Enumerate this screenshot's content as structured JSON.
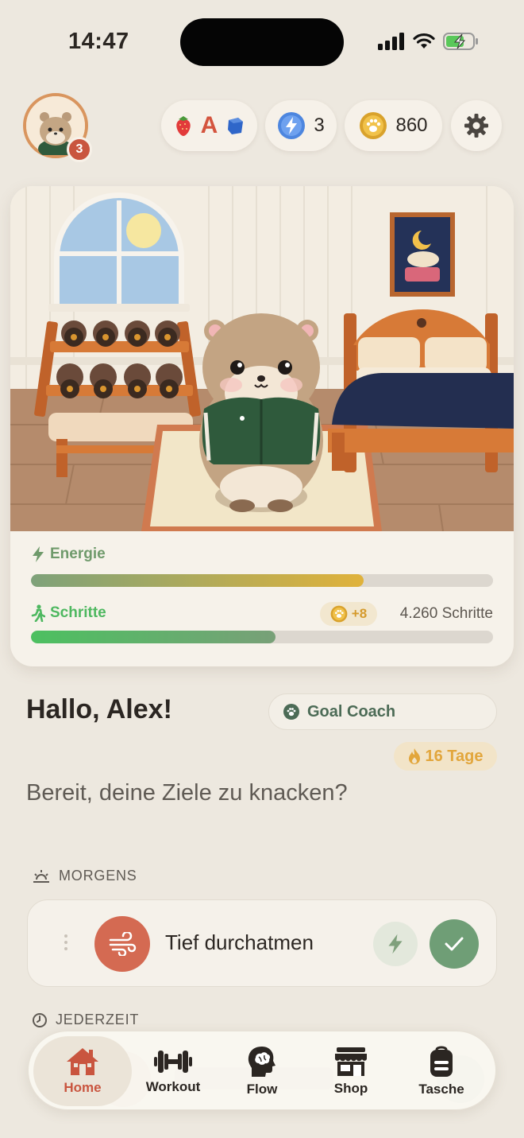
{
  "status_bar": {
    "time": "14:47"
  },
  "profile": {
    "level_badge": "3"
  },
  "currencies": {
    "energy": "3",
    "coins": "860",
    "letter_pill_text": "A"
  },
  "stats": {
    "energy": {
      "label": "Energie",
      "fraction": 0.72
    },
    "steps": {
      "label": "Schritte",
      "fraction": 0.53,
      "coin_bonus": "+8",
      "count_text": "4.260 Schritte"
    }
  },
  "greeting": {
    "title": "Hallo, Alex!",
    "subtitle": "Bereit, deine Ziele zu knacken?",
    "goal_coach": "Goal Coach",
    "streak": "16 Tage"
  },
  "sections": {
    "morning": {
      "header": "MORGENS",
      "task": {
        "title": "Tief durchatmen"
      }
    },
    "anytime": {
      "header": "JEDERZEIT"
    }
  },
  "tabs": [
    {
      "label": "Home",
      "active": true
    },
    {
      "label": "Workout",
      "active": false
    },
    {
      "label": "Flow",
      "active": false
    },
    {
      "label": "Shop",
      "active": false
    },
    {
      "label": "Tasche",
      "active": false
    }
  ],
  "colors": {
    "background": "#ede8df",
    "accent_red": "#c9553f",
    "check_green": "#6f9e76",
    "streak_gold": "#e2a63c"
  }
}
